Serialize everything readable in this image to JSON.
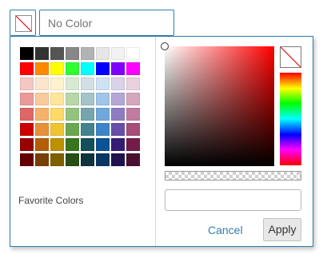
{
  "picker": {
    "value_placeholder": "No Color",
    "current_color": "none"
  },
  "palette": {
    "rows": [
      [
        "#000000",
        "#333333",
        "#555555",
        "#888888",
        "#b3b3b3",
        "#e6e6e6",
        "#f2f2f2",
        "#ffffff"
      ],
      [
        "#ff0000",
        "#ff8a00",
        "#ffff00",
        "#30ff30",
        "#00ffff",
        "#0000ff",
        "#8000ff",
        "#ff00ff"
      ],
      [
        "#f4c7c3",
        "#fce5cd",
        "#fff2cc",
        "#d9ead3",
        "#d0e0e3",
        "#cfe2f3",
        "#d9d2e9",
        "#ead1dc"
      ],
      [
        "#ea9999",
        "#f9cb9c",
        "#ffe599",
        "#b6d7a8",
        "#a2c4c9",
        "#9fc5e8",
        "#b4a7d6",
        "#d5a6bd"
      ],
      [
        "#e06666",
        "#f6b26b",
        "#ffd966",
        "#93c47d",
        "#76a5af",
        "#6fa8dc",
        "#8e7cc3",
        "#c27ba0"
      ],
      [
        "#cc0000",
        "#e69138",
        "#f1c232",
        "#6aa84f",
        "#45818e",
        "#3d85c6",
        "#674ea7",
        "#a64d79"
      ],
      [
        "#990000",
        "#b45f06",
        "#bf9000",
        "#38761d",
        "#134f5c",
        "#0b5394",
        "#351c75",
        "#741b47"
      ],
      [
        "#660000",
        "#783f04",
        "#7f6000",
        "#274e13",
        "#0c343d",
        "#073763",
        "#20124d",
        "#4c1130"
      ]
    ],
    "favorites_label": "Favorite Colors"
  },
  "editor": {
    "hue_color": "#ff0000",
    "hex_value": ""
  },
  "actions": {
    "cancel_label": "Cancel",
    "apply_label": "Apply"
  },
  "theme": {
    "accent": "#2f7fb0"
  }
}
